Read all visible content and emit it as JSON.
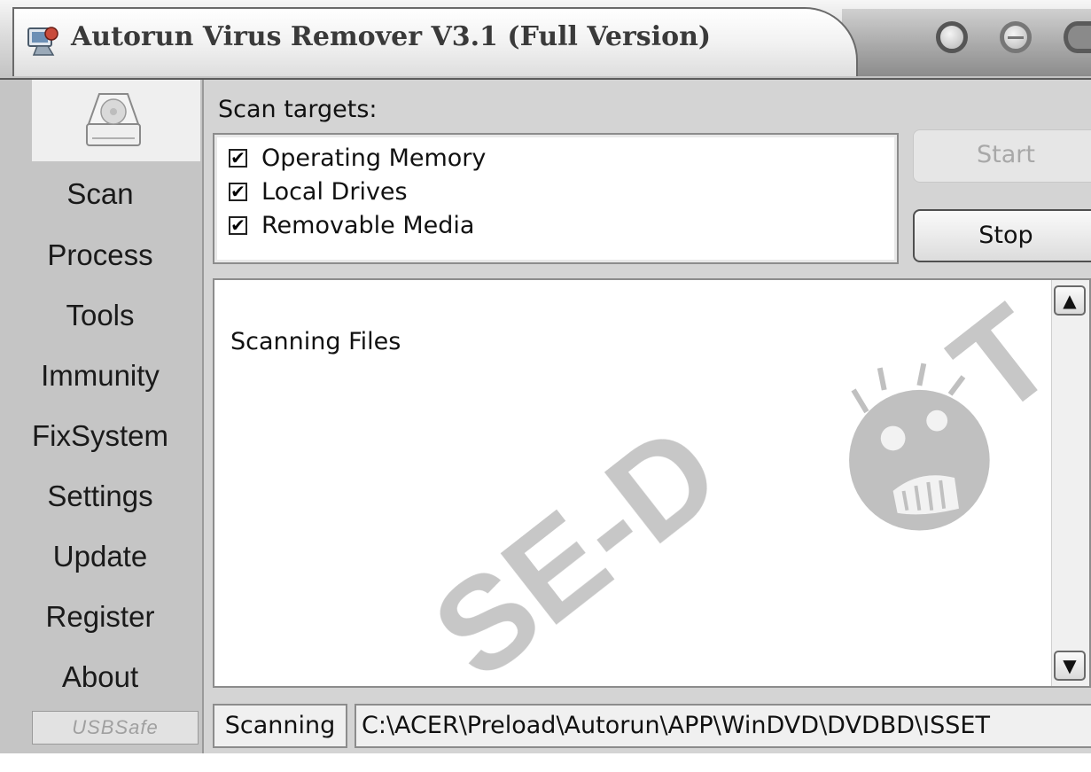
{
  "window": {
    "title": "Autorun Virus Remover V3.1 (Full Version)",
    "icon": "app-icon",
    "controls": [
      "minimize-icon",
      "maximize-icon",
      "close-icon"
    ]
  },
  "sidebar": {
    "icon": "drive-icon",
    "items": [
      {
        "label": "Scan"
      },
      {
        "label": "Process"
      },
      {
        "label": "Tools"
      },
      {
        "label": "Immunity"
      },
      {
        "label": "FixSystem"
      },
      {
        "label": "Settings"
      },
      {
        "label": "Update"
      },
      {
        "label": "Register"
      },
      {
        "label": "About"
      }
    ],
    "footer_logo": "USBSafe"
  },
  "scan": {
    "targets_label": "Scan targets:",
    "targets": [
      {
        "label": "Operating Memory",
        "checked": true
      },
      {
        "label": "Local Drives",
        "checked": true
      },
      {
        "label": "Removable Media",
        "checked": true
      }
    ],
    "start_label": "Start",
    "stop_label": "Stop",
    "start_enabled": false
  },
  "log": {
    "text": "Scanning Files",
    "watermark": "SE-DOT"
  },
  "status": {
    "label": "Scanning",
    "path": "C:\\ACER\\Preload\\Autorun\\APP\\WinDVD\\DVDBD\\ISSET"
  }
}
